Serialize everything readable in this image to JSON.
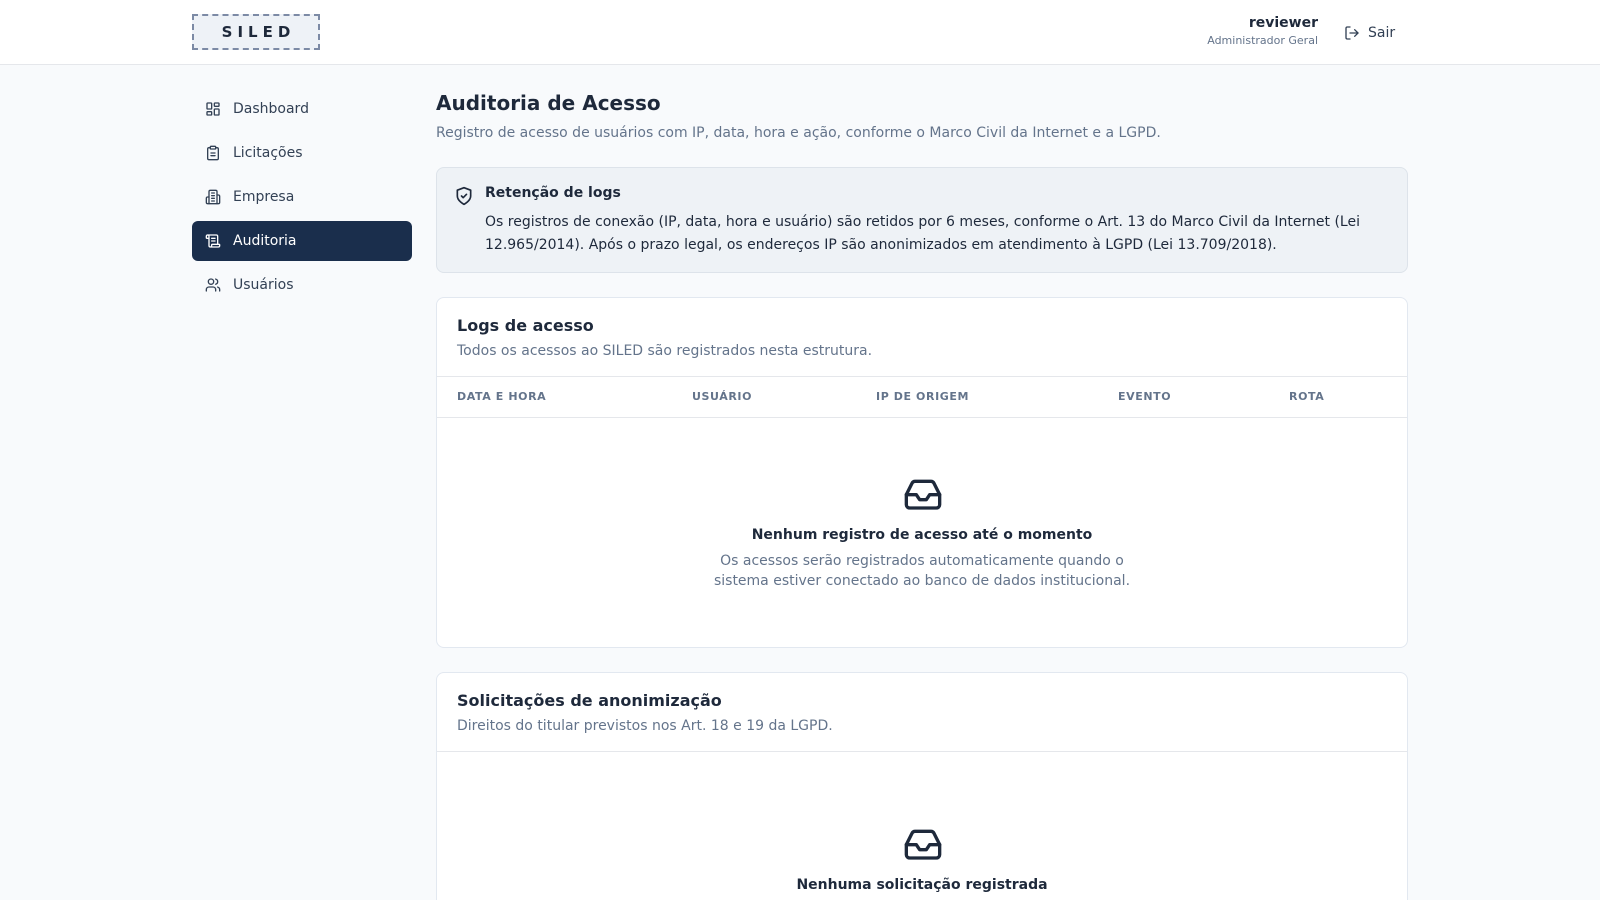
{
  "header": {
    "logo": "SILED",
    "user_name": "reviewer",
    "user_role": "Administrador Geral",
    "logout_label": "Sair"
  },
  "sidebar": {
    "items": [
      {
        "label": "Dashboard",
        "icon": "dashboard-icon",
        "active": false
      },
      {
        "label": "Licitações",
        "icon": "clipboard-icon",
        "active": false
      },
      {
        "label": "Empresa",
        "icon": "building-icon",
        "active": false
      },
      {
        "label": "Auditoria",
        "icon": "audit-scroll-icon",
        "active": true
      },
      {
        "label": "Usuários",
        "icon": "users-icon",
        "active": false
      }
    ]
  },
  "page": {
    "title": "Auditoria de Acesso",
    "subtitle": "Registro de acesso de usuários com IP, data, hora e ação, conforme o Marco Civil da Internet e a LGPD."
  },
  "notice": {
    "title": "Retenção de logs",
    "text": "Os registros de conexão (IP, data, hora e usuário) são retidos por 6 meses, conforme o Art. 13 do Marco Civil da Internet (Lei 12.965/2014). Após o prazo legal, os endereços IP são anonimizados em atendimento à LGPD (Lei 13.709/2018)."
  },
  "logs": {
    "title": "Logs de acesso",
    "subtitle": "Todos os acessos ao SILED são registrados nesta estrutura.",
    "columns": [
      "DATA E HORA",
      "USUÁRIO",
      "IP DE ORIGEM",
      "EVENTO",
      "ROTA"
    ],
    "empty_title": "Nenhum registro de acesso até o momento",
    "empty_desc": "Os acessos serão registrados automaticamente quando o sistema estiver conectado ao banco de dados institucional."
  },
  "anonymization": {
    "title": "Solicitações de anonimização",
    "subtitle": "Direitos do titular previstos nos Art. 18 e 19 da LGPD.",
    "empty_title": "Nenhuma solicitação registrada"
  },
  "colors": {
    "sidebar_active_bg": "#1a2e4c",
    "page_bg": "#f8fafc",
    "notice_bg": "#eef2f6"
  }
}
